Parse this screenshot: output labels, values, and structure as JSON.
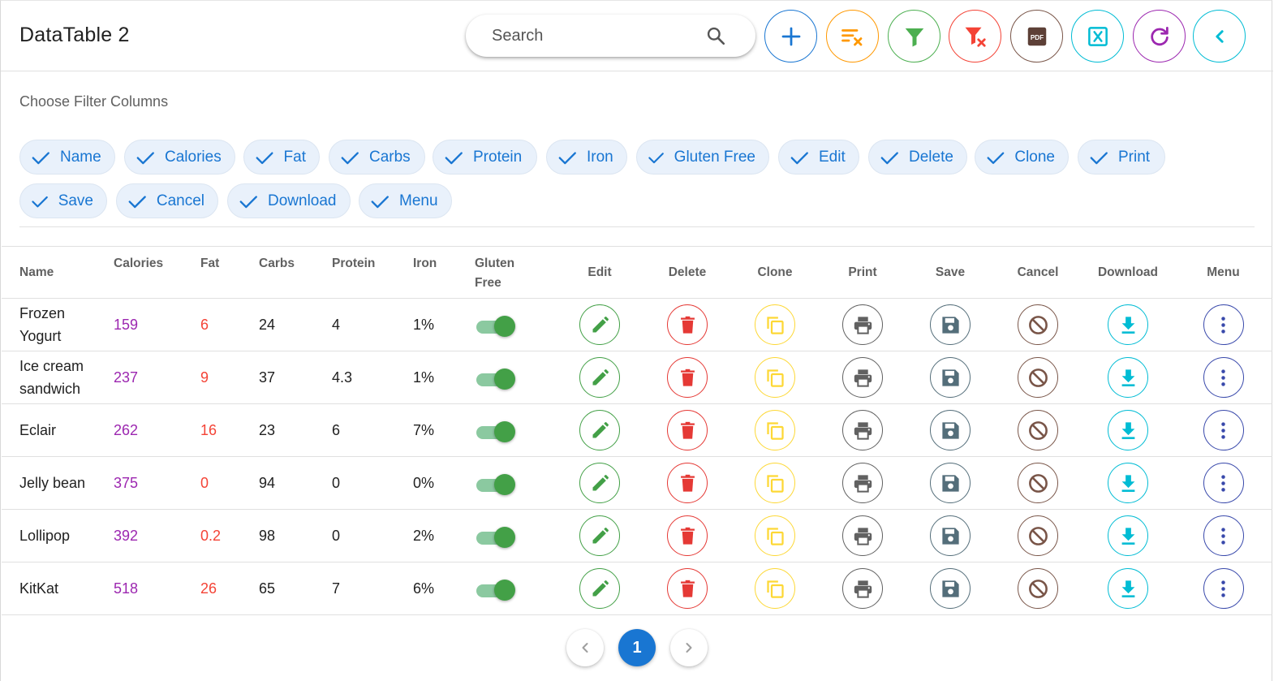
{
  "header": {
    "title": "DataTable 2"
  },
  "search": {
    "placeholder": "Search",
    "icon": "search-icon"
  },
  "toolbar_buttons": [
    {
      "name": "add-button",
      "icon": "plus-icon",
      "color": "#1976d2"
    },
    {
      "name": "clear-sort-button",
      "icon": "sort-clear-icon",
      "color": "#ff9800"
    },
    {
      "name": "filter-button",
      "icon": "filter-icon",
      "color": "#4caf50"
    },
    {
      "name": "clear-filter-button",
      "icon": "filter-remove-icon",
      "color": "#f44336"
    },
    {
      "name": "export-pdf-button",
      "icon": "pdf-icon",
      "color": "#795548"
    },
    {
      "name": "export-excel-button",
      "icon": "excel-icon",
      "color": "#00bcd4"
    },
    {
      "name": "refresh-button",
      "icon": "refresh-icon",
      "color": "#9c27b0"
    },
    {
      "name": "collapse-button",
      "icon": "chevron-left-icon",
      "color": "#00bcd4"
    }
  ],
  "filter": {
    "label": "Choose Filter Columns",
    "chips": [
      "Name",
      "Calories",
      "Fat",
      "Carbs",
      "Protein",
      "Iron",
      "Gluten Free",
      "Edit",
      "Delete",
      "Clone",
      "Print",
      "Save",
      "Cancel",
      "Download",
      "Menu"
    ]
  },
  "table": {
    "headers": {
      "name": "Name",
      "calories": "Calories",
      "fat": "Fat",
      "carbs": "Carbs",
      "protein": "Protein",
      "iron": "Iron",
      "gluten_line1": "Gluten",
      "gluten_line2": "Free",
      "edit": "Edit",
      "delete": "Delete",
      "clone": "Clone",
      "print": "Print",
      "save": "Save",
      "cancel": "Cancel",
      "download": "Download",
      "menu": "Menu"
    },
    "rows": [
      {
        "name_line1": "Frozen",
        "name_line2": "Yogurt",
        "calories": "159",
        "fat": "6",
        "carbs": "24",
        "protein": "4",
        "iron": "1%",
        "gluten_free": true
      },
      {
        "name_line1": "Ice cream",
        "name_line2": "sandwich",
        "calories": "237",
        "fat": "9",
        "carbs": "37",
        "protein": "4.3",
        "iron": "1%",
        "gluten_free": true
      },
      {
        "name_line1": "Eclair",
        "name_line2": "",
        "calories": "262",
        "fat": "16",
        "carbs": "23",
        "protein": "6",
        "iron": "7%",
        "gluten_free": true
      },
      {
        "name_line1": "Jelly bean",
        "name_line2": "",
        "calories": "375",
        "fat": "0",
        "carbs": "94",
        "protein": "0",
        "iron": "0%",
        "gluten_free": true
      },
      {
        "name_line1": "Lollipop",
        "name_line2": "",
        "calories": "392",
        "fat": "0.2",
        "carbs": "98",
        "protein": "0",
        "iron": "2%",
        "gluten_free": true
      },
      {
        "name_line1": "KitKat",
        "name_line2": "",
        "calories": "518",
        "fat": "26",
        "carbs": "65",
        "protein": "7",
        "iron": "6%",
        "gluten_free": true
      }
    ],
    "action_colors": {
      "edit": "#43a047",
      "delete": "#e53935",
      "clone": "#fdd835",
      "print": "#616161",
      "save": "#546e7a",
      "cancel": "#795548",
      "download": "#00bcd4",
      "menu": "#3949ab"
    }
  },
  "pagination": {
    "current_page": "1"
  }
}
